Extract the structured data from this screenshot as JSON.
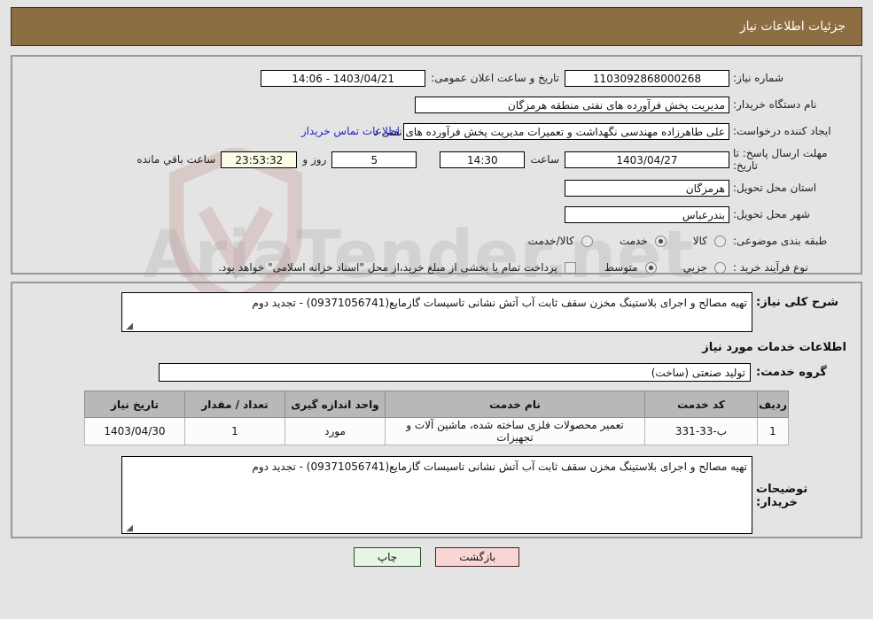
{
  "header": {
    "title": "جزئیات اطلاعات نیاز"
  },
  "watermark": {
    "text": "AriaTender.net"
  },
  "form": {
    "need_number": {
      "label": "شماره نیاز:",
      "value": "1103092868000268"
    },
    "public_announcement": {
      "label": "تاریخ و ساعت اعلان عمومی:",
      "value": "1403/04/21 - 14:06"
    },
    "buyer_org": {
      "label": "نام دستگاه خریدار:",
      "value": "مدیریت پخش فرآورده های نفتی منطقه هرمزگان"
    },
    "request_creator": {
      "label": "ایجاد کننده درخواست:",
      "value": "علی طاهرزاده مهندسی نگهداشت و تعمیرات مدیریت پخش فرآورده های نفتی د",
      "link": "اطلاعات تماس خریدار"
    },
    "deadline": {
      "label": "مهلت ارسال پاسخ: تا تاریخ:",
      "date": "1403/04/27",
      "time_label": "ساعت",
      "time": "14:30",
      "days": "5",
      "days_label": "روز و",
      "remaining": "23:53:32",
      "remaining_label": "ساعت باقي مانده"
    },
    "delivery_province": {
      "label": "استان محل تحویل:",
      "value": "هرمزگان"
    },
    "delivery_city": {
      "label": "شهر محل تحویل:",
      "value": "بندرعباس"
    },
    "subject_category": {
      "label": "طبقه بندی موضوعی:",
      "options": [
        {
          "label": "کالا",
          "selected": false
        },
        {
          "label": "خدمت",
          "selected": true
        },
        {
          "label": "کالا/خدمت",
          "selected": false
        }
      ]
    },
    "purchase_process": {
      "label": "نوع فرآیند خرید :",
      "options": [
        {
          "label": "جزیي",
          "selected": false
        },
        {
          "label": "متوسط",
          "selected": true
        }
      ],
      "checkbox_note": "پرداخت تمام یا بخشی از مبلغ خرید،از محل \"اسناد خزانه اسلامی\" خواهد بود.",
      "checkbox_checked": false
    }
  },
  "details": {
    "general_description": {
      "label": "شرح کلی نیاز:",
      "value": "تهیه مصالح و اجرای بلاستینگ مخزن سقف ثابت آب آتش نشانی تاسیسات گازمایع(09371056741) - تجدید دوم"
    },
    "services_section_title": "اطلاعات خدمات مورد نیاز",
    "service_group": {
      "label": "گروه خدمت:",
      "value": "تولید صنعتی (ساخت)"
    },
    "table": {
      "columns": [
        "ردیف",
        "کد خدمت",
        "نام خدمت",
        "واحد اندازه گیری",
        "تعداد / مقدار",
        "تاریخ نیاز"
      ],
      "rows": [
        {
          "radif": "1",
          "code": "ب-33-331",
          "name": "تعمیر محصولات فلزی ساخته شده، ماشین آلات و تجهیزات",
          "unit": "مورد",
          "qty": "1",
          "date": "1403/04/30"
        }
      ]
    },
    "buyer_notes": {
      "label": "توضیحات خریدار:",
      "value": "تهیه مصالح و اجرای بلاستینگ مخزن سقف ثابت آب آتش نشانی تاسیسات گازمایع(09371056741) - تجدید دوم"
    }
  },
  "buttons": {
    "back": "بازگشت",
    "print": "چاپ"
  },
  "colors": {
    "header_bg": "#8d6e43",
    "back_btn_bg": "#f9d6d6",
    "print_btn_bg": "#e7f6e4",
    "table_header_bg": "#b8b8b8",
    "link": "#2222cc",
    "countdown_bg": "#fbfbe8"
  }
}
